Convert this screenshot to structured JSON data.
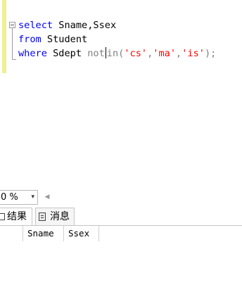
{
  "editor": {
    "line1": {
      "kw": "select",
      "rest": " Sname,Ssex"
    },
    "line2": {
      "kw": "from",
      "rest": " Student"
    },
    "line3": {
      "kw": "where",
      "mid": " Sdept ",
      "op_not": "not",
      "op_in": "in",
      "paren_open": "(",
      "s1": "'cs'",
      "comma1": ",",
      "s2": "'ma'",
      "comma2": ",",
      "s3": "'is'",
      "paren_close": ")",
      "semi": ";"
    }
  },
  "status": {
    "zoom": "0 %",
    "zoom_arrow": "▾",
    "scroll_left": "◀"
  },
  "tabs": {
    "results": "结果",
    "messages": "消息"
  },
  "grid": {
    "columns": [
      "Sname",
      "Ssex"
    ]
  }
}
